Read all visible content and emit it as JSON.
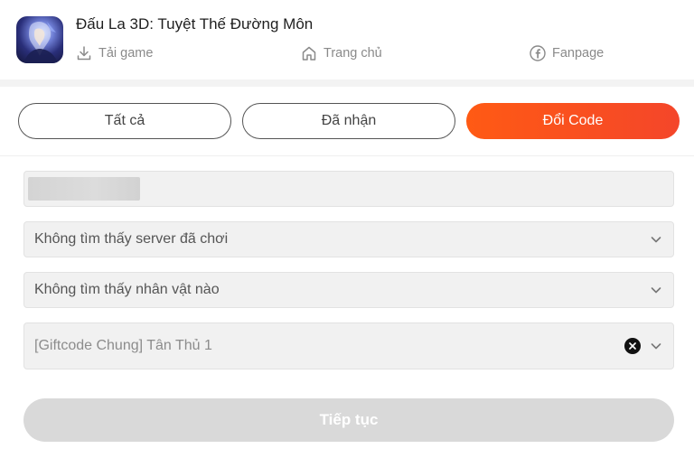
{
  "header": {
    "app_title": "Đấu La 3D: Tuyệt Thế Đường Môn",
    "links": {
      "download": {
        "label": "Tải game",
        "icon": "download-icon"
      },
      "home": {
        "label": "Trang chủ",
        "icon": "home-icon"
      },
      "fanpage": {
        "label": "Fanpage",
        "icon": "facebook-icon"
      }
    }
  },
  "tabs": {
    "all": "Tất cả",
    "received": "Đã nhận",
    "redeem": "Đổi Code",
    "active": "redeem"
  },
  "form": {
    "server_select": "Không tìm thấy server đã chơi",
    "character_select": "Không tìm thấy nhân vật nào",
    "giftcode_select": "[Giftcode Chung] Tân Thủ 1",
    "submit_label": "Tiếp tục"
  },
  "colors": {
    "accent_start": "#ff5a14",
    "accent_end": "#f4462a",
    "disabled_button": "#d9d9d9",
    "field_bg": "#f1f1f1"
  }
}
